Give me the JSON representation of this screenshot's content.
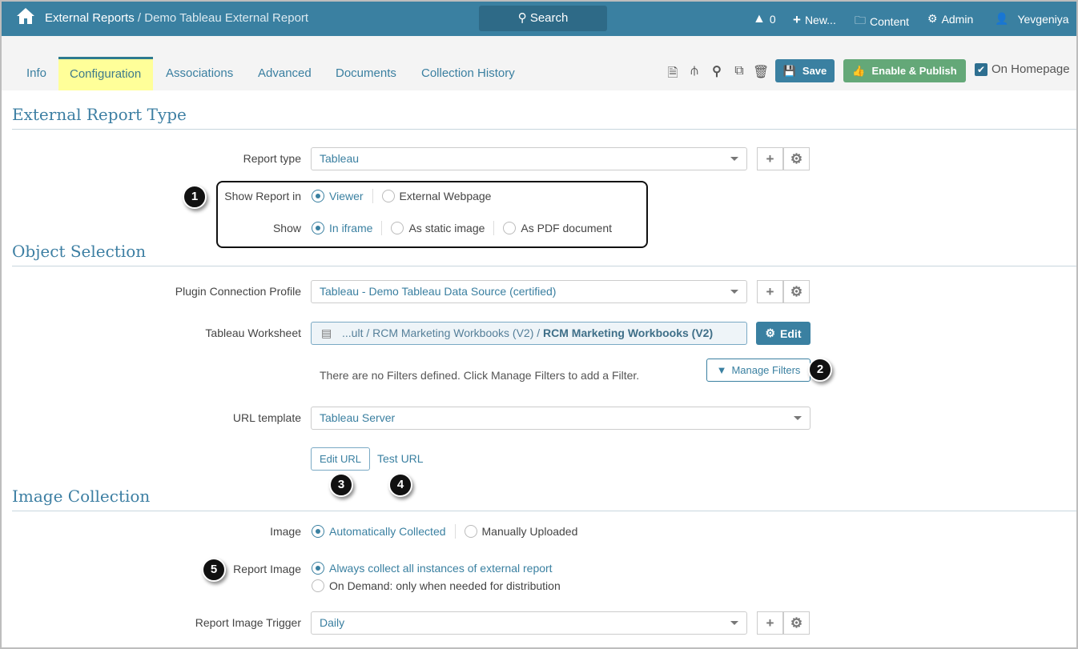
{
  "topbar": {
    "breadcrumb_root": "External Reports",
    "breadcrumb_sep": " / ",
    "breadcrumb_current": "Demo Tableau External Report",
    "search_label": "Search",
    "alerts_count": "0",
    "new_label": "New...",
    "content_label": "Content",
    "admin_label": "Admin",
    "user_name": "Yevgeniya"
  },
  "tabs": [
    {
      "label": "Info"
    },
    {
      "label": "Configuration"
    },
    {
      "label": "Associations"
    },
    {
      "label": "Advanced"
    },
    {
      "label": "Documents"
    },
    {
      "label": "Collection History"
    }
  ],
  "toolbar": {
    "save_label": "Save",
    "publish_label": "Enable & Publish",
    "homepage_label": "On Homepage"
  },
  "sections": {
    "report_type": "External Report Type",
    "object_selection": "Object Selection",
    "image_collection": "Image Collection"
  },
  "form": {
    "report_type_label": "Report type",
    "report_type_value": "Tableau",
    "show_report_in_label": "Show Report in",
    "show_report_in_options": [
      "Viewer",
      "External Webpage"
    ],
    "show_label": "Show",
    "show_options": [
      "In iframe",
      "As static image",
      "As PDF document"
    ],
    "plugin_label": "Plugin Connection Profile",
    "plugin_value": "Tableau - Demo Tableau Data Source (certified)",
    "worksheet_label": "Tableau Worksheet",
    "worksheet_path": "...ult / RCM Marketing Workbooks (V2) / ",
    "worksheet_name": "RCM Marketing Workbooks (V2)",
    "edit_label": "Edit",
    "filters_text": "There are no Filters defined. Click Manage Filters to add a Filter.",
    "manage_filters_label": "Manage Filters",
    "url_template_label": "URL template",
    "url_template_value": "Tableau Server",
    "edit_url_label": "Edit URL",
    "test_url_label": "Test URL",
    "image_label": "Image",
    "image_options": [
      "Automatically Collected",
      "Manually Uploaded"
    ],
    "report_image_label": "Report Image",
    "report_image_options": [
      "Always collect all instances of external report",
      "On Demand: only when needed for distribution"
    ],
    "trigger_label": "Report Image Trigger",
    "trigger_value": "Daily"
  },
  "callouts": [
    "1",
    "2",
    "3",
    "4",
    "5"
  ]
}
